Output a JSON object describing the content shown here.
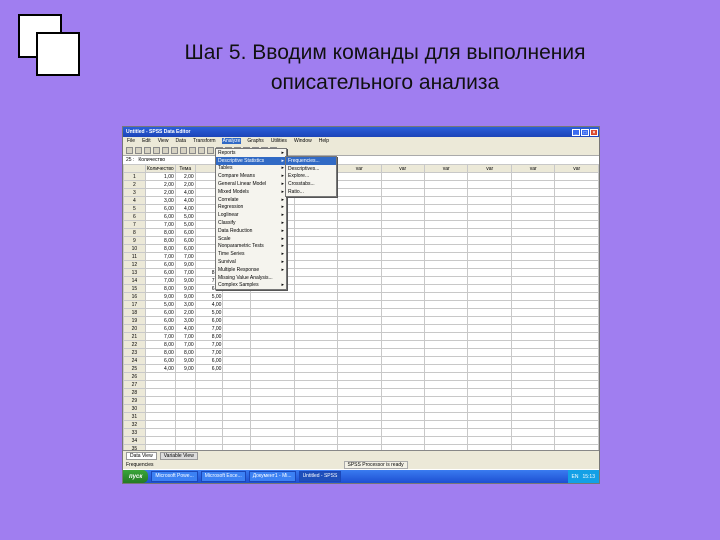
{
  "slide": {
    "title_line1": "Шаг 5. Вводим команды для выполнения",
    "title_line2": "описательного анализа"
  },
  "window": {
    "title": "Untitled - SPSS Data Editor",
    "controls": [
      "_",
      "□",
      "×"
    ]
  },
  "menu": [
    "File",
    "Edit",
    "View",
    "Data",
    "Transform",
    "Analyze",
    "Graphs",
    "Utilities",
    "Window",
    "Help"
  ],
  "menu_active": "Analyze",
  "cellref": {
    "name": "25 :",
    "value": "Количество"
  },
  "grid": {
    "headers": [
      "",
      "Количество",
      "Тема",
      "",
      "",
      "var",
      "var",
      "var",
      "var",
      "var",
      "var",
      "var",
      "var"
    ],
    "rows": [
      [
        "1",
        "1,00",
        "2,00",
        "",
        ""
      ],
      [
        "2",
        "2,00",
        "2,00",
        "",
        ""
      ],
      [
        "3",
        "2,00",
        "4,00",
        "",
        ""
      ],
      [
        "4",
        "3,00",
        "4,00",
        "",
        ""
      ],
      [
        "5",
        "6,00",
        "4,00",
        "",
        ""
      ],
      [
        "6",
        "6,00",
        "5,00",
        "",
        ""
      ],
      [
        "7",
        "7,00",
        "5,00",
        "",
        ""
      ],
      [
        "8",
        "8,00",
        "6,00",
        "",
        ""
      ],
      [
        "9",
        "8,00",
        "6,00",
        "",
        ""
      ],
      [
        "10",
        "8,00",
        "6,00",
        "",
        ""
      ],
      [
        "11",
        "7,00",
        "7,00",
        "",
        ""
      ],
      [
        "12",
        "6,00",
        "9,00",
        "",
        ""
      ],
      [
        "13",
        "6,00",
        "7,00",
        "8,00",
        ""
      ],
      [
        "14",
        "7,00",
        "9,00",
        "7,00",
        ""
      ],
      [
        "15",
        "8,00",
        "9,00",
        "6,00",
        ""
      ],
      [
        "16",
        "9,00",
        "9,00",
        "5,00",
        ""
      ],
      [
        "17",
        "5,00",
        "3,00",
        "4,00",
        ""
      ],
      [
        "18",
        "6,00",
        "2,00",
        "5,00",
        ""
      ],
      [
        "19",
        "6,00",
        "3,00",
        "6,00",
        ""
      ],
      [
        "20",
        "6,00",
        "4,00",
        "7,00",
        ""
      ],
      [
        "21",
        "7,00",
        "7,00",
        "8,00",
        ""
      ],
      [
        "22",
        "8,00",
        "7,00",
        "7,00",
        ""
      ],
      [
        "23",
        "8,00",
        "8,00",
        "7,00",
        ""
      ],
      [
        "24",
        "6,00",
        "9,00",
        "6,00",
        ""
      ],
      [
        "25",
        "4,00",
        "9,00",
        "6,00",
        ""
      ],
      [
        "26",
        "",
        "",
        "",
        ""
      ],
      [
        "27",
        "",
        "",
        "",
        ""
      ],
      [
        "28",
        "",
        "",
        "",
        ""
      ],
      [
        "29",
        "",
        "",
        "",
        ""
      ],
      [
        "30",
        "",
        "",
        "",
        ""
      ],
      [
        "31",
        "",
        "",
        "",
        ""
      ],
      [
        "32",
        "",
        "",
        "",
        ""
      ],
      [
        "33",
        "",
        "",
        "",
        ""
      ],
      [
        "34",
        "",
        "",
        "",
        ""
      ],
      [
        "35",
        "",
        "",
        "",
        ""
      ]
    ]
  },
  "analyze_menu": [
    {
      "label": "Reports",
      "sub": true
    },
    {
      "label": "Descriptive Statistics",
      "sub": true,
      "highlight": true
    },
    {
      "label": "Tables",
      "sub": true
    },
    {
      "label": "Compare Means",
      "sub": true
    },
    {
      "label": "General Linear Model",
      "sub": true
    },
    {
      "label": "Mixed Models",
      "sub": true
    },
    {
      "label": "Correlate",
      "sub": true
    },
    {
      "label": "Regression",
      "sub": true
    },
    {
      "label": "Loglinear",
      "sub": true
    },
    {
      "label": "Classify",
      "sub": true
    },
    {
      "label": "Data Reduction",
      "sub": true
    },
    {
      "label": "Scale",
      "sub": true
    },
    {
      "label": "Nonparametric Tests",
      "sub": true
    },
    {
      "label": "Time Series",
      "sub": true
    },
    {
      "label": "Survival",
      "sub": true
    },
    {
      "label": "Multiple Response",
      "sub": true
    },
    {
      "label": "Missing Value Analysis...",
      "sub": false
    },
    {
      "label": "Complex Samples",
      "sub": true
    }
  ],
  "descriptive_submenu": [
    {
      "label": "Frequencies...",
      "highlight": true
    },
    {
      "label": "Descriptives..."
    },
    {
      "label": "Explore..."
    },
    {
      "label": "Crosstabs..."
    },
    {
      "label": "Ratio..."
    }
  ],
  "tabs": {
    "data_view": "Data View",
    "variable_view": "Variable View"
  },
  "status": {
    "left": "Frequencies",
    "processor": "SPSS Processor is ready"
  },
  "taskbar": {
    "start": "пуск",
    "items": [
      "Microsoft Powe...",
      "Microsoft Exce...",
      "Документ1 - Mi...",
      "Untitled - SPSS"
    ],
    "lang": "EN",
    "time": "15:13"
  }
}
